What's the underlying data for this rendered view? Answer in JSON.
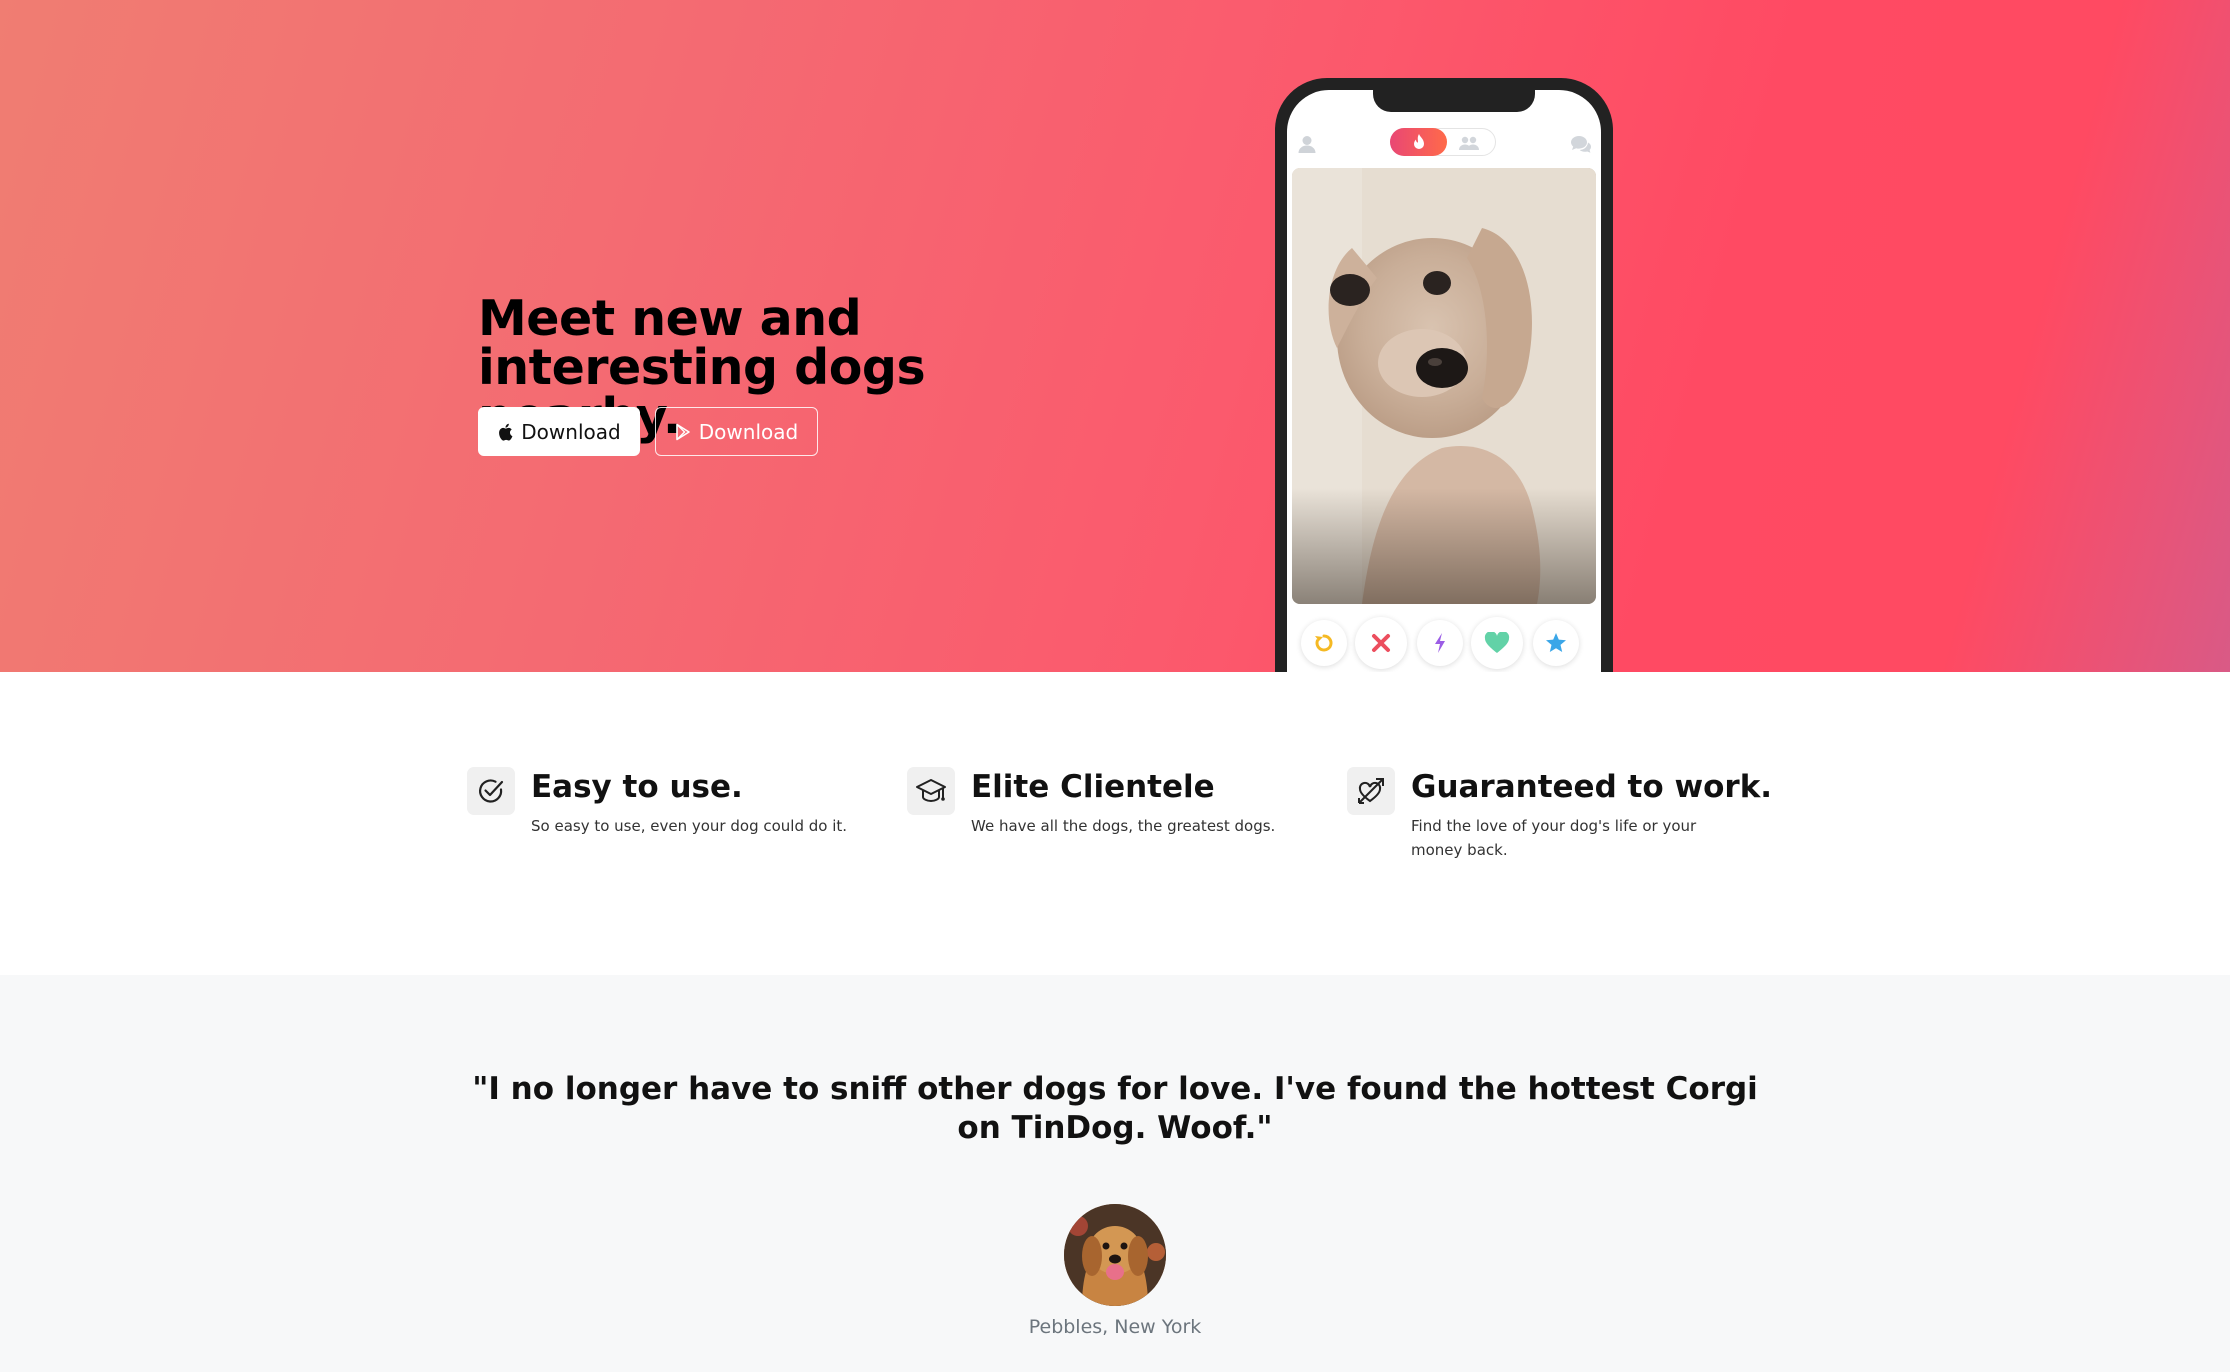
{
  "hero": {
    "headline": "Meet new and interesting dogs nearby.",
    "buttons": [
      {
        "label": "Download",
        "icon": "apple-icon"
      },
      {
        "label": "Download",
        "icon": "google-play-icon"
      }
    ]
  },
  "phone": {
    "top_icons": [
      "profile-icon",
      "flame-icon",
      "group-icon",
      "chat-icon"
    ],
    "action_buttons": [
      "rewind-icon",
      "nope-icon",
      "boost-icon",
      "like-icon",
      "super-like-icon"
    ]
  },
  "features": [
    {
      "title": "Easy to use.",
      "text": "So easy to use, even your dog could do it.",
      "icon": "check-circle-icon"
    },
    {
      "title": "Elite Clientele",
      "text": "We have all the dogs, the greatest dogs.",
      "icon": "graduation-cap-icon"
    },
    {
      "title": "Guaranteed to work.",
      "text": "Find the love of your dog's life or your money back.",
      "icon": "heart-arrow-icon"
    }
  ],
  "testimonial": {
    "quote": "\"I no longer have to sniff other dogs for love. I've found the hottest Corgi on TinDog. Woof.\"",
    "author": "Pebbles, New York"
  },
  "colors": {
    "hero_gradient_start": "#f07d72",
    "hero_gradient_end": "#ff4a63",
    "testimonial_bg": "#f7f8f9"
  }
}
